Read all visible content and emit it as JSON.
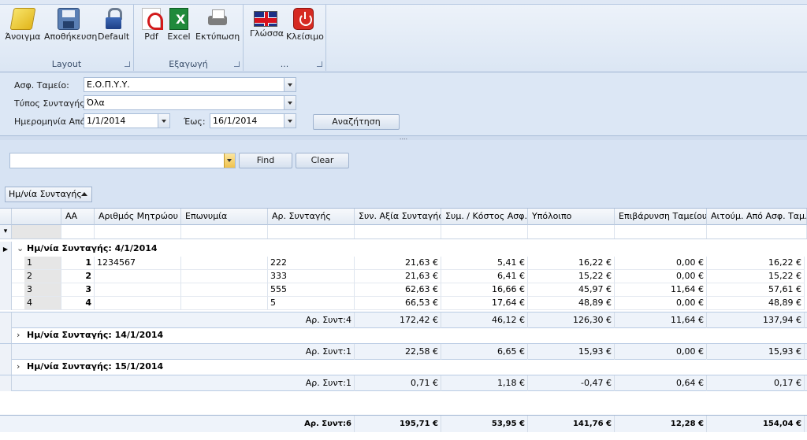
{
  "ribbon": {
    "groups": [
      {
        "label": "Layout",
        "buttons": [
          {
            "label": "Άνοιγμα",
            "icon": "folder-open-icon"
          },
          {
            "label": "Αποθήκευση",
            "icon": "save-icon"
          },
          {
            "label": "Default",
            "icon": "lock-icon"
          }
        ]
      },
      {
        "label": "Εξαγωγή",
        "buttons": [
          {
            "label": "Pdf",
            "icon": "pdf-icon"
          },
          {
            "label": "Excel",
            "icon": "excel-icon"
          },
          {
            "label": "Εκτύπωση",
            "icon": "printer-icon"
          }
        ]
      },
      {
        "label": "...",
        "buttons": [
          {
            "label": "Γλώσσα",
            "icon": "uk-flag-icon"
          },
          {
            "label": "Κλείσιμο",
            "icon": "power-icon"
          }
        ]
      }
    ]
  },
  "filters": {
    "fund_label": "Ασφ. Ταμείο:",
    "fund_value": "Ε.Ο.Π.Υ.Υ.",
    "type_label": "Τύπος Συνταγής:",
    "type_value": "Όλα",
    "from_label": "Ημερομηνία Από:",
    "from_value": "1/1/2014",
    "to_label": "Έως:",
    "to_value": "16/1/2014",
    "search_button": "Αναζήτηση"
  },
  "findbar": {
    "value": "",
    "find_button": "Find",
    "clear_button": "Clear"
  },
  "group_panel": {
    "chip_label": "Ημ/νία Συνταγής"
  },
  "grid": {
    "columns": [
      "ΑΑ",
      "Αριθμός Μητρώου",
      "Επωνυμία",
      "Αρ. Συνταγής",
      "Συν. Αξία Συνταγής",
      "Συμ. / Κόστος Ασφ.",
      "Υπόλοιπο",
      "Επιβάρυνση Ταμείου",
      "Αιτούμ. Από Ασφ. Ταμ..."
    ],
    "groups": [
      {
        "title": "Ημ/νία Συνταγής: 4/1/2014",
        "rows": [
          {
            "n": "1",
            "aa": "1",
            "mitroo": "1234567",
            "eponymia": "",
            "syntagi": "222",
            "axia": "21,63 €",
            "symmetoxi": "5,41 €",
            "ypoloipo": "16,22 €",
            "epivarynsi": "0,00 €",
            "aitoum": "16,22 €"
          },
          {
            "n": "2",
            "aa": "2",
            "mitroo": "",
            "eponymia": "",
            "syntagi": "333",
            "axia": "21,63 €",
            "symmetoxi": "6,41 €",
            "ypoloipo": "15,22 €",
            "epivarynsi": "0,00 €",
            "aitoum": "15,22 €"
          },
          {
            "n": "3",
            "aa": "3",
            "mitroo": "",
            "eponymia": "",
            "syntagi": "555",
            "axia": "62,63 €",
            "symmetoxi": "16,66 €",
            "ypoloipo": "45,97 €",
            "epivarynsi": "11,64 €",
            "aitoum": "57,61 €"
          },
          {
            "n": "4",
            "aa": "4",
            "mitroo": "",
            "eponymia": "",
            "syntagi": "5",
            "axia": "66,53 €",
            "symmetoxi": "17,64 €",
            "ypoloipo": "48,89 €",
            "epivarynsi": "0,00 €",
            "aitoum": "48,89 €"
          }
        ],
        "summary": {
          "count": "Αρ. Συντ:4",
          "axia": "172,42 €",
          "symmetoxi": "46,12 €",
          "ypoloipo": "126,30 €",
          "epivarynsi": "11,64 €",
          "aitoum": "137,94 €"
        }
      },
      {
        "title": "Ημ/νία Συνταγής: 14/1/2014",
        "summary": {
          "count": "Αρ. Συντ:1",
          "axia": "22,58 €",
          "symmetoxi": "6,65 €",
          "ypoloipo": "15,93 €",
          "epivarynsi": "0,00 €",
          "aitoum": "15,93 €"
        }
      },
      {
        "title": "Ημ/νία Συνταγής: 15/1/2014",
        "summary": {
          "count": "Αρ. Συντ:1",
          "axia": "0,71 €",
          "symmetoxi": "1,18 €",
          "ypoloipo": "-0,47 €",
          "epivarynsi": "0,64 €",
          "aitoum": "0,17 €"
        }
      }
    ],
    "total": {
      "count": "Αρ. Συντ:6",
      "axia": "195,71 €",
      "symmetoxi": "53,95 €",
      "ypoloipo": "141,76 €",
      "epivarynsi": "12,28 €",
      "aitoum": "154,04 €"
    }
  }
}
